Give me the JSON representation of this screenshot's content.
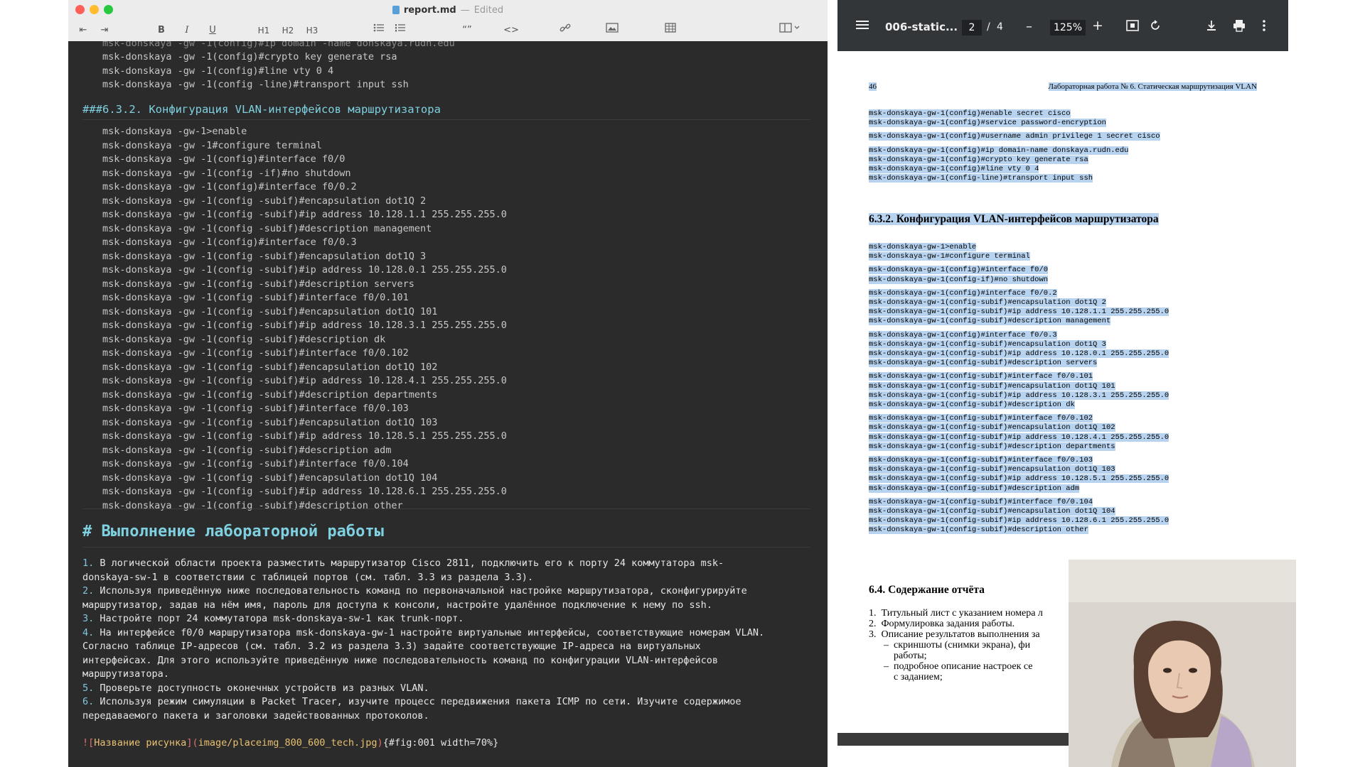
{
  "editor": {
    "title": "report.md",
    "separator": "—",
    "status": "Edited",
    "toolbar": {
      "outdent": "⇤",
      "indent": "⇥",
      "bold": "B",
      "italic": "I",
      "underline": "U",
      "h1": "H1",
      "h2": "H2",
      "h3": "H3",
      "quote": "“”",
      "code": "<>"
    },
    "code_top": [
      "msk-donskaya -gw -1(config)#crypto key generate rsa",
      "msk-donskaya -gw -1(config)#line vty 0 4",
      "msk-donskaya -gw -1(config -line)#transport input ssh"
    ],
    "heading_632_hash": "###",
    "heading_632": "6.3.2. Конфигурация VLAN-интерфейсов маршрутизатора",
    "code_vlan": [
      "msk-donskaya -gw-1>enable",
      "msk-donskaya -gw -1#configure terminal",
      "msk-donskaya -gw -1(config)#interface f0/0",
      "msk-donskaya -gw -1(config -if)#no shutdown",
      "msk-donskaya -gw -1(config)#interface f0/0.2",
      "msk-donskaya -gw -1(config -subif)#encapsulation dot1Q 2",
      "msk-donskaya -gw -1(config -subif)#ip address 10.128.1.1 255.255.255.0",
      "msk-donskaya -gw -1(config -subif)#description management",
      "msk-donskaya -gw -1(config)#interface f0/0.3",
      "msk-donskaya -gw -1(config -subif)#encapsulation dot1Q 3",
      "msk-donskaya -gw -1(config -subif)#ip address 10.128.0.1 255.255.255.0",
      "msk-donskaya -gw -1(config -subif)#description servers",
      "msk-donskaya -gw -1(config -subif)#interface f0/0.101",
      "msk-donskaya -gw -1(config -subif)#encapsulation dot1Q 101",
      "msk-donskaya -gw -1(config -subif)#ip address 10.128.3.1 255.255.255.0",
      "msk-donskaya -gw -1(config -subif)#description dk",
      "msk-donskaya -gw -1(config -subif)#interface f0/0.102",
      "msk-donskaya -gw -1(config -subif)#encapsulation dot1Q 102",
      "msk-donskaya -gw -1(config -subif)#ip address 10.128.4.1 255.255.255.0",
      "msk-donskaya -gw -1(config -subif)#description departments",
      "msk-donskaya -gw -1(config -subif)#interface f0/0.103",
      "msk-donskaya -gw -1(config -subif)#encapsulation dot1Q 103",
      "msk-donskaya -gw -1(config -subif)#ip address 10.128.5.1 255.255.255.0",
      "msk-donskaya -gw -1(config -subif)#description adm",
      "msk-donskaya -gw -1(config -subif)#interface f0/0.104",
      "msk-donskaya -gw -1(config -subif)#encapsulation dot1Q 104",
      "msk-donskaya -gw -1(config -subif)#ip address 10.128.6.1 255.255.255.0",
      "msk-donskaya -gw -1(config -subif)#description other"
    ],
    "heading_main": "# Выполнение лабораторной работы",
    "list": [
      {
        "n": "1.",
        "lines": [
          "В логической области проекта разместить маршрутизатор Cisco 2811, подключить его к порту 24 коммутатора msk-",
          "donskaya-sw-1 в соответствии с таблицей портов (см. табл. 3.3 из раздела 3.3)."
        ]
      },
      {
        "n": "2.",
        "lines": [
          "Используя приведённую ниже последовательность команд по первоначальной настройке маршрутизатора, сконфигурируйте",
          "маршрутизатор, задав на нём имя, пароль для доступа к консоли, настройте удалённое подключение к нему по ssh."
        ]
      },
      {
        "n": "3.",
        "lines": [
          "Настройте порт 24 коммутатора msk-donskaya-sw-1 как trunk-порт."
        ]
      },
      {
        "n": "4.",
        "lines": [
          "На интерфейсе f0/0 маршрутизатора msk-donskaya-gw-1 настройте виртуальные интерфейсы, соответствующие номерам VLAN.",
          "Согласно таблице IP-адресов (см. табл. 3.2 из раздела 3.3) задайте соответствующие IP-адреса на виртуальных",
          "интерфейсах. Для этого используйте приведённую ниже последовательность команд по конфигурации VLAN-интерфейсов",
          "маршрутизатора."
        ]
      },
      {
        "n": "5.",
        "lines": [
          "Проверьте доступность оконечных устройств из разных VLAN."
        ]
      },
      {
        "n": "6.",
        "lines": [
          "Используя режим симуляции в Packet Tracer, изучите процесс передвижения пакета ICMP по сети. Изучите содержимое",
          "передаваемого пакета и заголовки задействованных протоколов."
        ]
      }
    ],
    "image_line": {
      "open": "![",
      "alt": "Название рисунка",
      "mid": "](",
      "src": "image/placeimg_800_600_tech.jpg",
      "close": ")",
      "attr": "{#fig:001 width=70%}"
    }
  },
  "pdf": {
    "filename": "006-static...",
    "page_current": "2",
    "page_sep": "/",
    "page_total": "4",
    "zoom": "125%",
    "header_left": "46",
    "header_right": "Лабораторная работа № 6. Статическая маршрутизация VLAN",
    "code_top": [
      "msk-donskaya-gw-1(config)#enable secret cisco",
      "msk-donskaya-gw-1(config)#service password-encryption",
      "",
      "msk-donskaya-gw-1(config)#username admin privilege 1 secret cisco",
      "",
      "msk-donskaya-gw-1(config)#ip domain-name donskaya.rudn.edu",
      "msk-donskaya-gw-1(config)#crypto key generate rsa",
      "msk-donskaya-gw-1(config)#line vty 0 4",
      "msk-donskaya-gw-1(config-line)#transport input ssh"
    ],
    "section_632": "6.3.2.   Конфигурация VLAN-интерфейсов маршрутизатора",
    "code_vlan": [
      "msk-donskaya-gw-1>enable",
      "msk-donskaya-gw-1#configure terminal",
      "",
      "msk-donskaya-gw-1(config)#interface f0/0",
      "msk-donskaya-gw-1(config-if)#no shutdown",
      "",
      "msk-donskaya-gw-1(config)#interface f0/0.2",
      "msk-donskaya-gw-1(config-subif)#encapsulation dot1Q 2",
      "msk-donskaya-gw-1(config-subif)#ip address 10.128.1.1 255.255.255.0",
      "msk-donskaya-gw-1(config-subif)#description management",
      "",
      "msk-donskaya-gw-1(config)#interface f0/0.3",
      "msk-donskaya-gw-1(config-subif)#encapsulation dot1Q 3",
      "msk-donskaya-gw-1(config-subif)#ip address 10.128.0.1 255.255.255.0",
      "msk-donskaya-gw-1(config-subif)#description servers",
      "",
      "msk-donskaya-gw-1(config-subif)#interface f0/0.101",
      "msk-donskaya-gw-1(config-subif)#encapsulation dot1Q 101",
      "msk-donskaya-gw-1(config-subif)#ip address 10.128.3.1 255.255.255.0",
      "msk-donskaya-gw-1(config-subif)#description dk",
      "",
      "msk-donskaya-gw-1(config-subif)#interface f0/0.102",
      "msk-donskaya-gw-1(config-subif)#encapsulation dot1Q 102",
      "msk-donskaya-gw-1(config-subif)#ip address 10.128.4.1 255.255.255.0",
      "msk-donskaya-gw-1(config-subif)#description departments",
      "",
      "msk-donskaya-gw-1(config-subif)#interface f0/0.103",
      "msk-donskaya-gw-1(config-subif)#encapsulation dot1Q 103",
      "msk-donskaya-gw-1(config-subif)#ip address 10.128.5.1 255.255.255.0",
      "msk-donskaya-gw-1(config-subif)#description adm",
      "",
      "msk-donskaya-gw-1(config-subif)#interface f0/0.104",
      "msk-donskaya-gw-1(config-subif)#encapsulation dot1Q 104",
      "msk-donskaya-gw-1(config-subif)#ip address 10.128.6.1 255.255.255.0",
      "msk-donskaya-gw-1(config-subif)#description other"
    ],
    "section_64": "6.4.   Содержание отчёта",
    "report_items": [
      "1.  Титульный лист с указанием номера л",
      "2.  Формулировка задания работы.",
      "3.  Описание результатов выполнения за",
      "      –  скриншоты (снимки экрана), фи",
      "          работы;",
      "      –  подробное описание настроек се",
      "          с заданием;"
    ]
  }
}
